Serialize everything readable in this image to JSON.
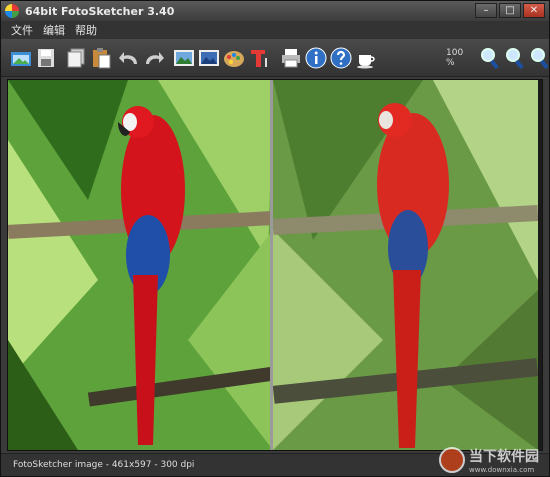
{
  "window": {
    "title": "64bit FotoSketcher 3.40",
    "minimize": "–",
    "maximize": "□",
    "close": "✕"
  },
  "menu": {
    "items": [
      "文件",
      "编辑",
      "帮助"
    ]
  },
  "toolbar": {
    "zoom": "100 %"
  },
  "status": {
    "text": "FotoSketcher image - 461x597 - 300 dpi"
  },
  "watermark": {
    "name": "当下软件园",
    "url": "www.downxia.com"
  },
  "colors": {
    "parrot_red": "#d4141c",
    "parrot_blue": "#1f4fa8",
    "foliage": "#3f8f2c"
  }
}
